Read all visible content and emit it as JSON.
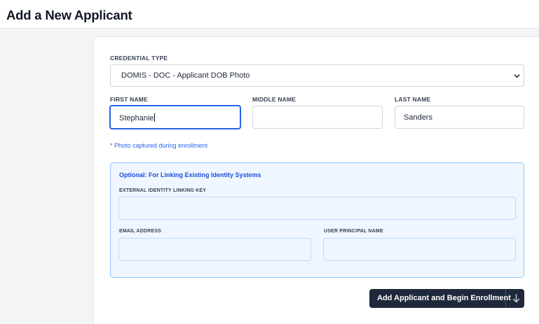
{
  "header": {
    "title": "Add a New Applicant"
  },
  "form": {
    "credential_type_label": "CREDENTIAL TYPE",
    "credential_type_value": "DOMIS - DOC - Applicant DOB Photo",
    "first_name_label": "FIRST NAME",
    "first_name_value": "Stephanie",
    "middle_name_label": "MIDDLE NAME",
    "middle_name_value": "",
    "last_name_label": "LAST NAME",
    "last_name_value": "Sanders",
    "photo_note": "* Photo captured during enrollment"
  },
  "linking_panel": {
    "title": "Optional: For Linking Existing Identity Systems",
    "external_key_label": "EXTERNAL IDENTITY LINKING KEY",
    "external_key_value": "",
    "email_label": "EMAIL ADDRESS",
    "email_value": "",
    "upn_label": "USER PRINCIPAL NAME",
    "upn_value": ""
  },
  "actions": {
    "submit_label": "Add Applicant and Begin Enrollment",
    "dropdown_icon": "arrow-down-icon"
  },
  "colors": {
    "accent": "#2563eb",
    "button_bg": "#1e293b",
    "panel_bg": "#eff6ff",
    "panel_border": "#93c5fd"
  }
}
